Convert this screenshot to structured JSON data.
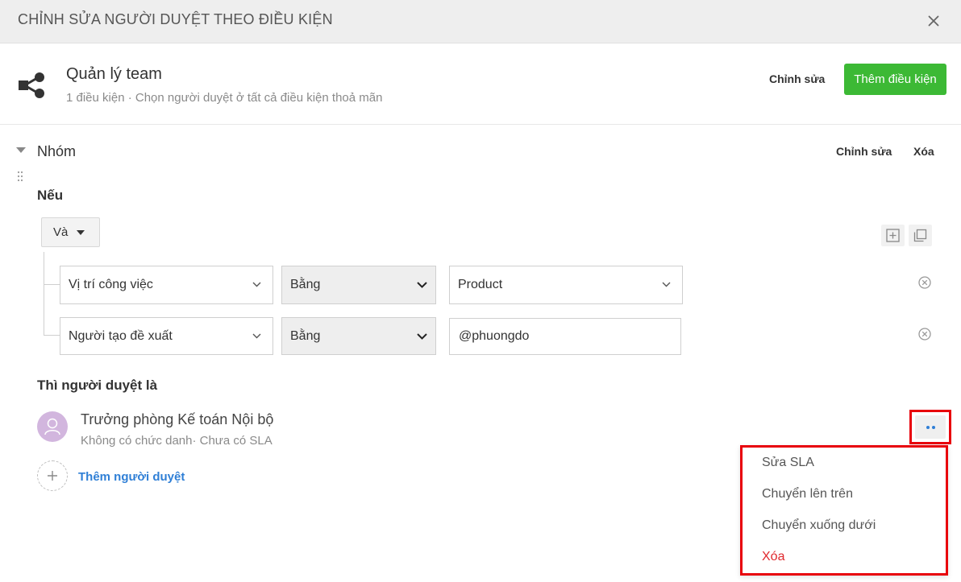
{
  "dialog": {
    "title": "CHỈNH SỬA NGƯỜI DUYỆT THEO ĐIỀU KIỆN"
  },
  "summary": {
    "title": "Quản lý team",
    "subtitle": "1 điều kiện · Chọn người duyệt ở tất cả điều kiện thoả mãn",
    "edit_label": "Chỉnh sửa",
    "add_condition_label": "Thêm điều kiện"
  },
  "group": {
    "title": "Nhóm",
    "edit_label": "Chỉnh sửa",
    "delete_label": "Xóa",
    "if_label": "Nếu",
    "operator_label": "Và",
    "conditions": [
      {
        "field": "Vị trí công việc",
        "comparator": "Bằng",
        "value": "Product"
      },
      {
        "field": "Người tạo đề xuất",
        "comparator": "Bằng",
        "value": "@phuongdo"
      }
    ]
  },
  "approvers": {
    "label": "Thì người duyệt là",
    "items": [
      {
        "name": "Trưởng phòng Kế toán Nội bộ",
        "subtitle": "Không có chức danh· Chưa có SLA"
      }
    ],
    "add_label": "Thêm người duyệt"
  },
  "context_menu": {
    "items": [
      {
        "label": "Sửa SLA"
      },
      {
        "label": "Chuyển lên trên"
      },
      {
        "label": "Chuyển xuống dưới"
      },
      {
        "label": "Xóa"
      }
    ]
  },
  "colors": {
    "primary_green": "#3cb935",
    "link_blue": "#2f7fd6",
    "highlight_red": "#e8000b",
    "danger_red": "#e0282d"
  },
  "icons": [
    "close-icon",
    "share-icon",
    "caret-down-icon",
    "drag-handle-icon",
    "add-square-icon",
    "copy-icon",
    "chevron-down-icon",
    "remove-circle-icon",
    "user-icon",
    "plus-icon",
    "more-icon"
  ]
}
